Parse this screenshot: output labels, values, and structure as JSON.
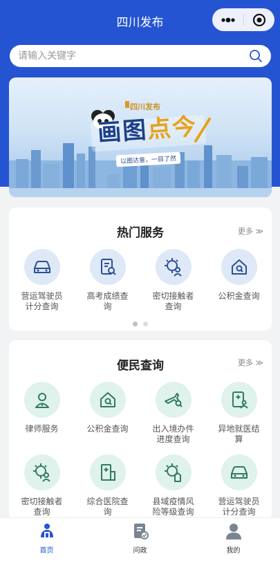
{
  "nav": {
    "title": "四川发布"
  },
  "search": {
    "placeholder": "请输入关键字"
  },
  "banner": {
    "logo_text": "四川发布",
    "title_part1": "画图",
    "title_part2": "点今",
    "subtitle": "以图达意，一目了然"
  },
  "hot_services": {
    "title": "热门服务",
    "more": "更多 ≫",
    "items": [
      {
        "label": "营运驾驶员\n计分查询",
        "icon": "car-icon"
      },
      {
        "label": "高考成绩查\n询",
        "icon": "document-search-icon"
      },
      {
        "label": "密切接触者\n查询",
        "icon": "virus-person-icon"
      },
      {
        "label": "公积金查询",
        "icon": "house-search-icon"
      }
    ]
  },
  "convenience": {
    "title": "便民查询",
    "more": "更多 ≫",
    "items": [
      {
        "label": "律师服务",
        "icon": "lawyer-icon"
      },
      {
        "label": "公积金查询",
        "icon": "house-search-icon"
      },
      {
        "label": "出入境办件\n进度查询",
        "icon": "plane-search-icon"
      },
      {
        "label": "异地就医结\n算",
        "icon": "medical-record-icon"
      },
      {
        "label": "密切接触者\n查询",
        "icon": "virus-person-icon"
      },
      {
        "label": "综合医院查\n询",
        "icon": "hospital-icon"
      },
      {
        "label": "县域疫情风\n险等级查询",
        "icon": "virus-building-icon"
      },
      {
        "label": "营运驾驶员\n计分查询",
        "icon": "car-icon"
      }
    ]
  },
  "tabbar": {
    "items": [
      {
        "label": "首页",
        "icon": "home-icon",
        "active": true
      },
      {
        "label": "问政",
        "icon": "inquiry-icon",
        "active": false
      },
      {
        "label": "我的",
        "icon": "profile-icon",
        "active": false
      }
    ]
  },
  "colors": {
    "primary": "#2554d2",
    "hot_icon_bg": "#dfe8f6",
    "conv_icon_bg": "#dff2ec",
    "hot_icon_stroke": "#2a4f95",
    "conv_icon_stroke": "#2f7a60"
  }
}
